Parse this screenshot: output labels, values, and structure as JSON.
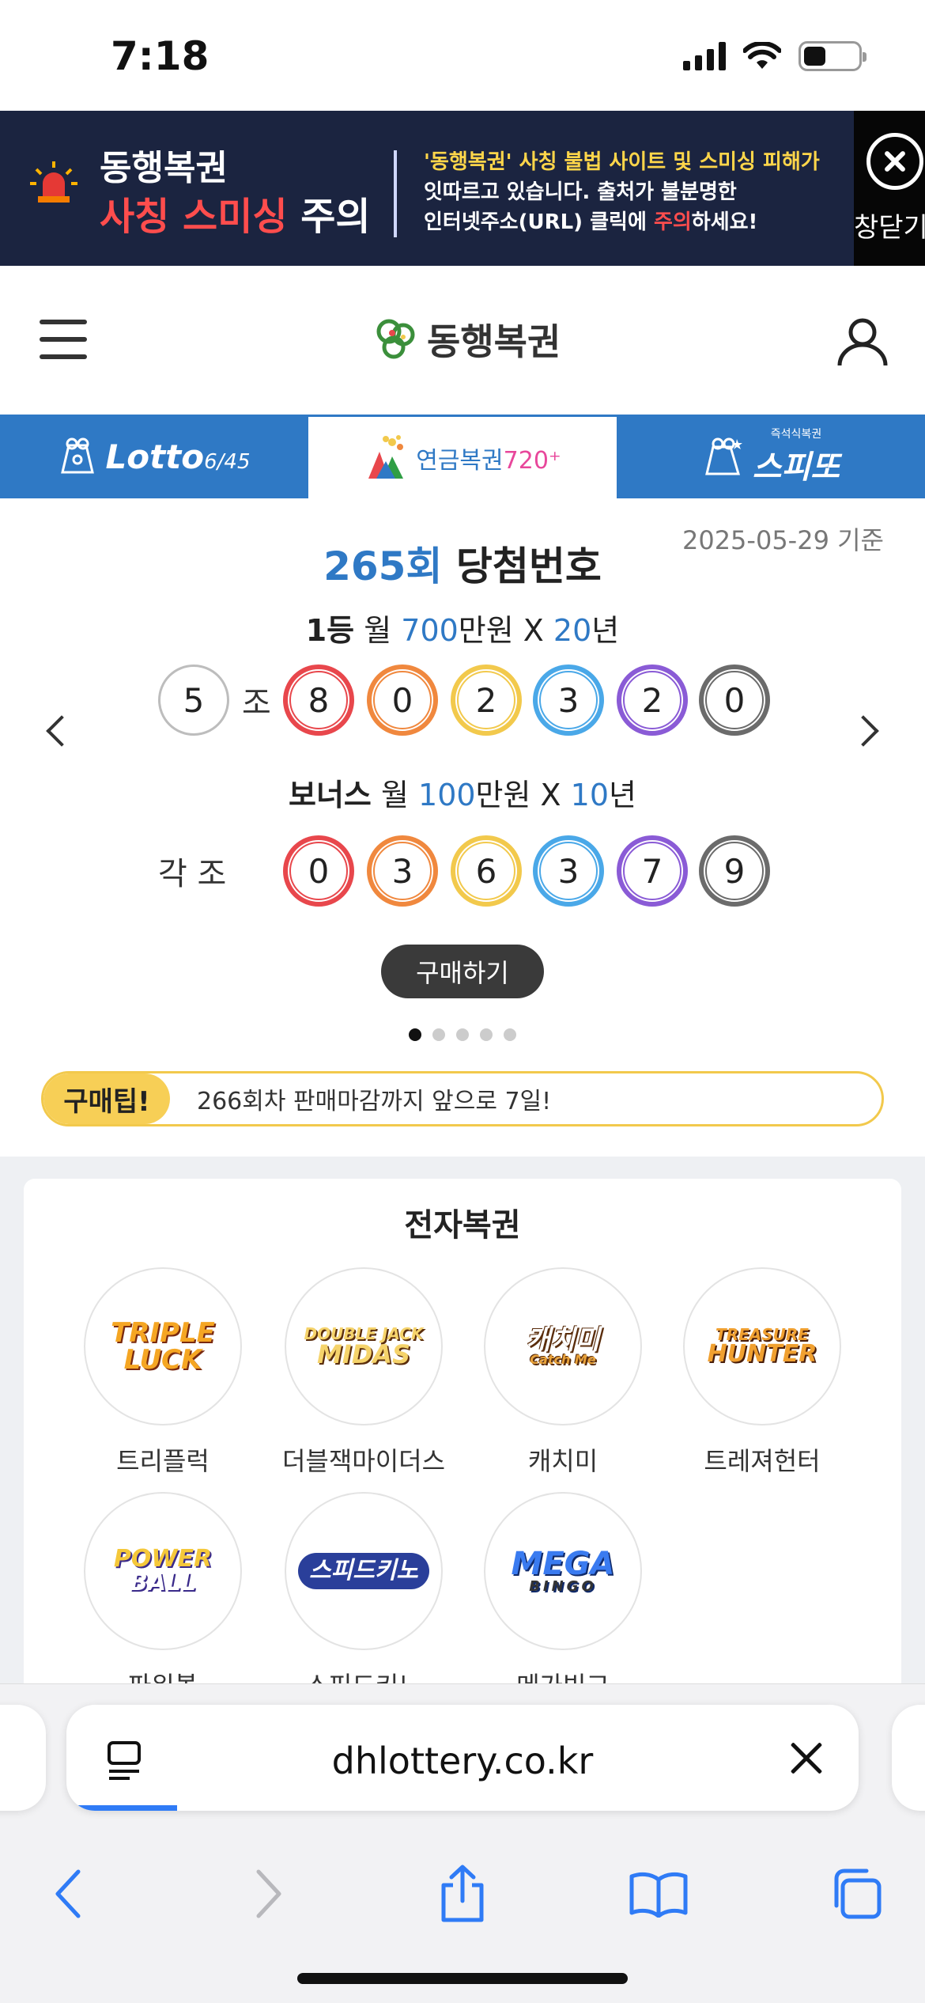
{
  "status_bar": {
    "time": "7:18",
    "battery_level": 0.42
  },
  "banner": {
    "title_line1": "동행복권",
    "title_line2_red": "사칭 스미싱",
    "title_line2_white": " 주의",
    "text_part1_yellow": "'동행복권' 사칭 불법 사이트 및 스미싱 피해가",
    "text_part2": "잇따르고 있습니다. 출처가 불분명한",
    "text_part3": "인터넷주소(URL) 클릭에 ",
    "text_part4_red": "주의",
    "text_part5": "하세요!",
    "close_label": "창닫기"
  },
  "header": {
    "logo_text": "동행복권"
  },
  "tabs": {
    "lotto": {
      "main": "Lotto",
      "sub": "6/45"
    },
    "pension": {
      "main": "연금복권",
      "suffix": "720⁺"
    },
    "speetto": {
      "sub": "즉석식복권",
      "main": "스피또"
    }
  },
  "draw": {
    "base_date": "2025-05-29 기준",
    "round": "265회",
    "title_suffix": " 당첨번호",
    "first_prize": {
      "rank": "1등",
      "pre": " 월 ",
      "amount": "700",
      "unit": "만원 X ",
      "years": "20",
      "years_unit": "년"
    },
    "first_numbers": {
      "group": "5",
      "group_label": "조",
      "digits": [
        "8",
        "0",
        "2",
        "3",
        "2",
        "0"
      ]
    },
    "bonus_prize": {
      "rank": "보너스",
      "pre": " 월 ",
      "amount": "100",
      "unit": "만원 X ",
      "years": "10",
      "years_unit": "년"
    },
    "bonus_numbers": {
      "group_label": "각 조",
      "digits": [
        "0",
        "3",
        "6",
        "3",
        "7",
        "9"
      ]
    },
    "ball_colors": [
      "#e8474c",
      "#f0883e",
      "#f2c94c",
      "#4aa8e8",
      "#8a5bd6",
      "#6b6b6b"
    ],
    "buy_label": "구매하기",
    "page_count": 5,
    "current_page": 1
  },
  "tip": {
    "badge": "구매팁!",
    "text": "266회차 판매마감까지 앞으로 7일!"
  },
  "e_lottery": {
    "title": "전자복권",
    "games": [
      {
        "label": "트리플럭",
        "logo": [
          "TRIPLE",
          "LUCK"
        ]
      },
      {
        "label": "더블잭마이더스",
        "logo": [
          "DOUBLE JACK",
          "MIDAS"
        ]
      },
      {
        "label": "캐치미",
        "logo": [
          "캐치미",
          "Catch Me"
        ]
      },
      {
        "label": "트레져헌터",
        "logo": [
          "TREASURE",
          "HUNTER"
        ]
      },
      {
        "label": "파워볼",
        "logo": [
          "POWER",
          "BALL"
        ]
      },
      {
        "label": "스피드키노",
        "logo": [
          "스피드키노",
          ""
        ]
      },
      {
        "label": "메가빙고",
        "logo": [
          "MEGA",
          "BINGO"
        ]
      }
    ]
  },
  "browser": {
    "url": "dhlottery.co.kr",
    "load_progress": 0.14
  }
}
